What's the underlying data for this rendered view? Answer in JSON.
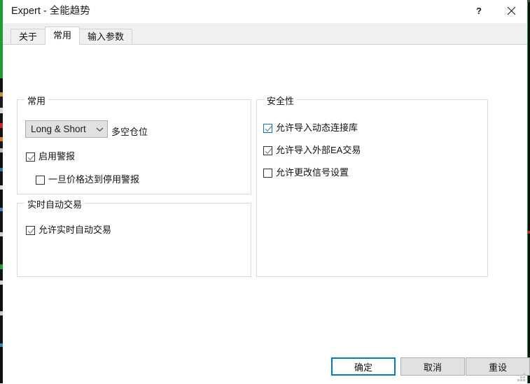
{
  "window": {
    "title": "Expert - 全能趋势",
    "help_label": "?",
    "close_label": "✕"
  },
  "tabs": [
    {
      "label": "关于",
      "active": false
    },
    {
      "label": "常用",
      "active": true
    },
    {
      "label": "输入参数",
      "active": false
    }
  ],
  "groups": {
    "general": {
      "legend": "常用",
      "position_combo": {
        "value": "Long & Short",
        "label": "多空仓位"
      },
      "checkboxes": [
        {
          "label": "启用警报",
          "checked": true,
          "focus": false
        },
        {
          "label": "一旦价格达到停用警报",
          "checked": false,
          "focus": false
        }
      ]
    },
    "live_trading": {
      "legend": "实时自动交易",
      "checkboxes": [
        {
          "label": "允许实时自动交易",
          "checked": true,
          "focus": false
        }
      ]
    },
    "security": {
      "legend": "安全性",
      "checkboxes": [
        {
          "label": "允许导入动态连接库",
          "checked": true,
          "focus": true
        },
        {
          "label": "允许导入外部EA交易",
          "checked": true,
          "focus": false
        },
        {
          "label": "允许更改信号设置",
          "checked": false,
          "focus": false
        }
      ]
    }
  },
  "footer": {
    "ok_label": "确定",
    "cancel_label": "取消",
    "reset_label": "重设"
  },
  "colors": {
    "accent": "#0078d7",
    "dialog_bg": "#ffffff",
    "tabstrip_bg": "#f0f0f0",
    "control_bg": "#e1e1e1",
    "group_border": "#dcdcdc",
    "text": "#111111",
    "chart_green": "#1f9e2f"
  }
}
